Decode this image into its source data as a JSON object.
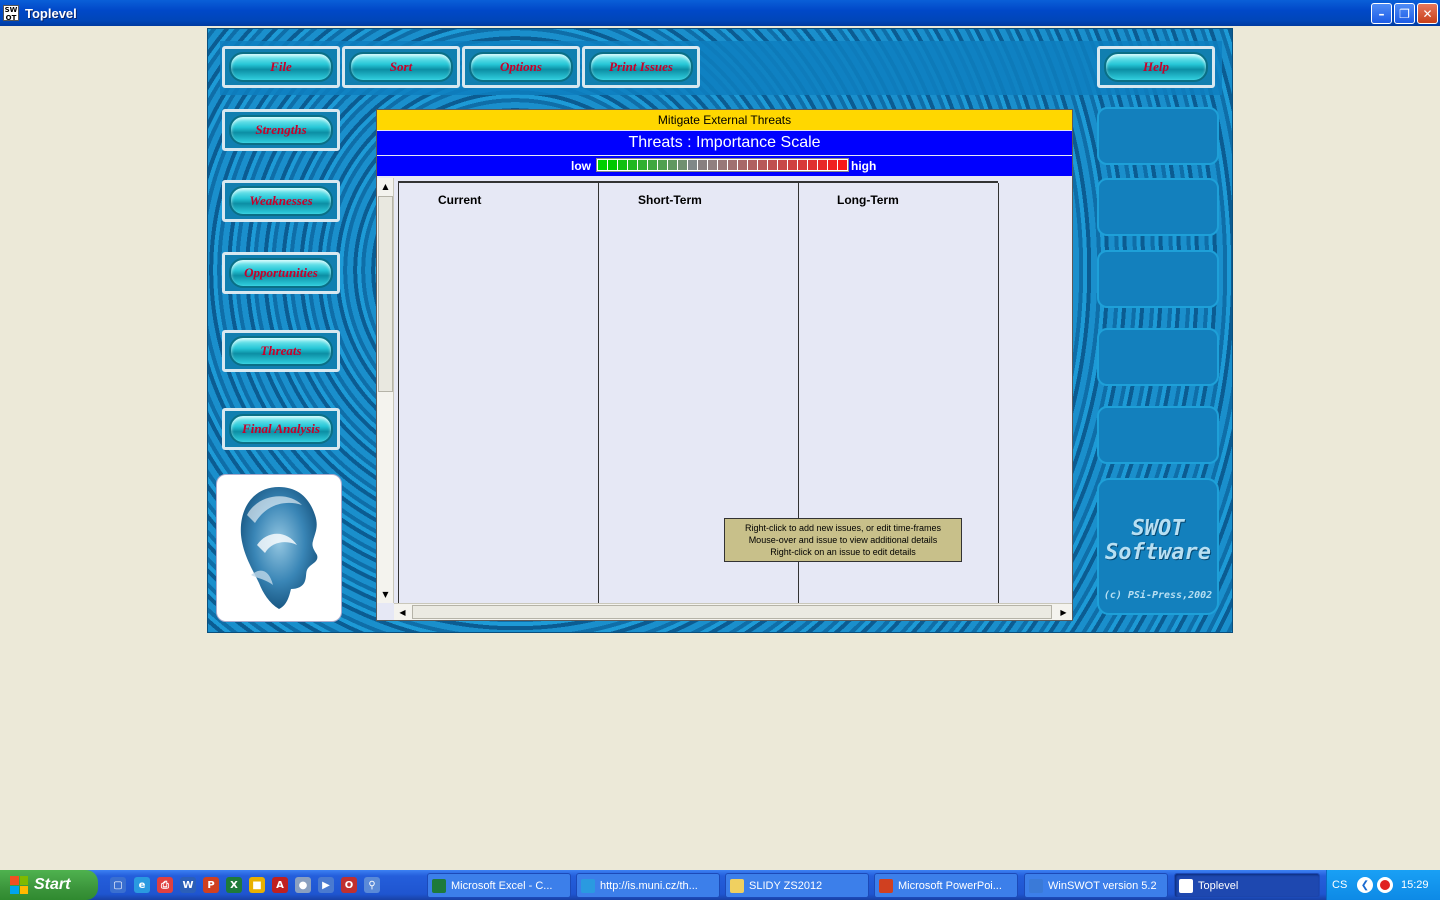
{
  "window": {
    "title": "Toplevel",
    "app_icon_text": "SW OT"
  },
  "toolbar": {
    "file": "File",
    "sort": "Sort",
    "options": "Options",
    "print": "Print Issues",
    "help": "Help"
  },
  "sidebar": {
    "strengths": "Strengths",
    "weaknesses": "Weaknesses",
    "opportunities": "Opportunities",
    "threats": "Threats",
    "final": "Final Analysis"
  },
  "panel": {
    "subheader": "Mitigate External Threats",
    "header": "Threats : Importance Scale",
    "scale_low": "low",
    "scale_high": "high",
    "scale_colors": [
      "#00d000",
      "#00c800",
      "#10c010",
      "#20b820",
      "#30b030",
      "#40a840",
      "#50a050",
      "#609860",
      "#709070",
      "#808888",
      "#888080",
      "#908080",
      "#987878",
      "#a07070",
      "#a86868",
      "#b06060",
      "#b85858",
      "#c05050",
      "#c84848",
      "#d04040",
      "#d83838",
      "#e03030",
      "#e82828",
      "#f02020",
      "#f81818"
    ],
    "columns": [
      "Current",
      "Short-Term",
      "Long-Term"
    ]
  },
  "tooltip": {
    "line1": "Right-click to add new issues, or edit time-frames",
    "line2": "Mouse-over and issue to view additional details",
    "line3": "Right-click on an issue to edit details"
  },
  "brand": {
    "line1": "SWOT",
    "line2": "Software",
    "line3": "(c) PSi-Press,2002"
  },
  "taskbar": {
    "start": "Start",
    "tasks": [
      "Microsoft Excel - C...",
      "http://is.muni.cz/th...",
      "SLIDY ZS2012",
      "Microsoft PowerPoi...",
      "WinSWOT version 5.2",
      "Toplevel"
    ],
    "lang": "CS",
    "clock": "15:29"
  }
}
